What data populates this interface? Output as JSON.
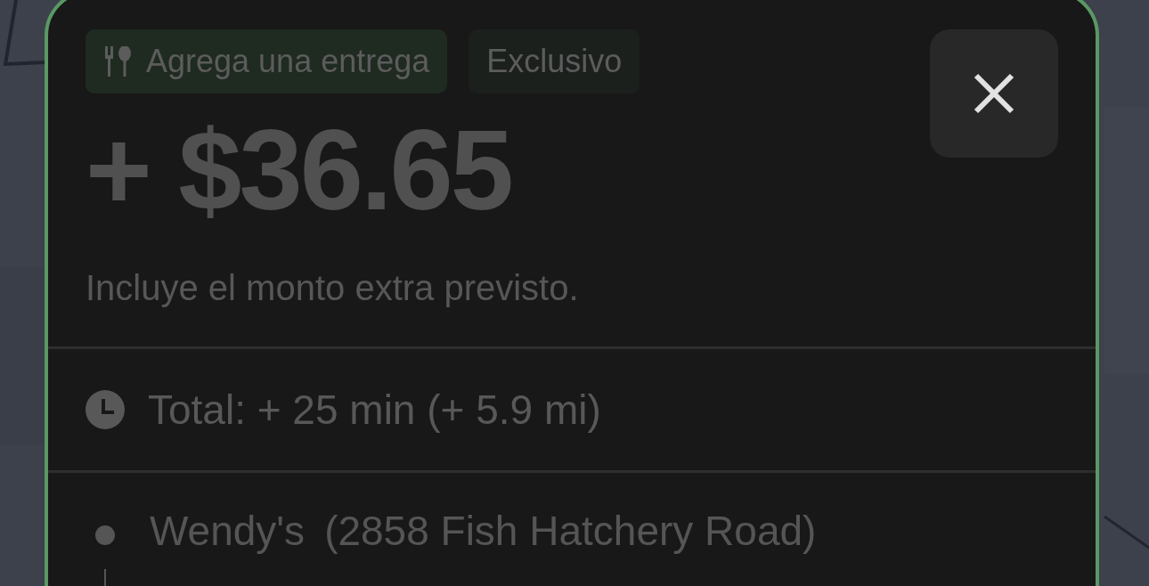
{
  "offer": {
    "tags": [
      {
        "label": "Agrega una entrega",
        "kind": "delivery"
      },
      {
        "label": "Exclusivo",
        "kind": "plain"
      }
    ],
    "amount": "+ $36.65",
    "note": "Incluye el monto extra previsto.",
    "total": "Total: + 25 min (+ 5.9 mi)",
    "stops": [
      {
        "name": "Wendy's",
        "address": "(2858 Fish Hatchery Road)"
      }
    ]
  }
}
